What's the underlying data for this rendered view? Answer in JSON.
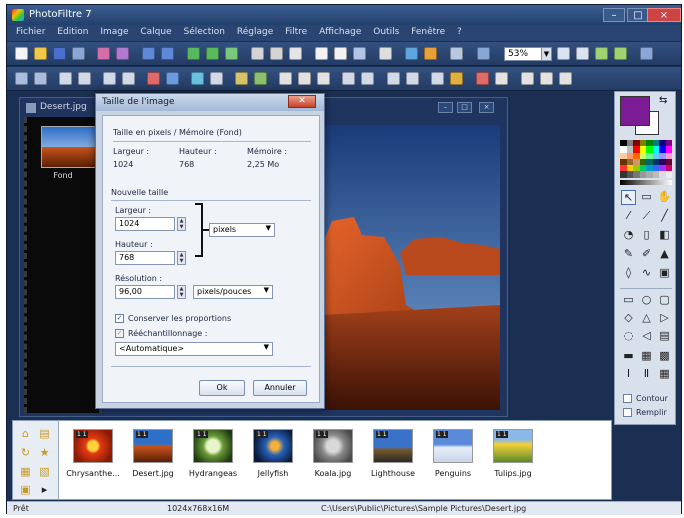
{
  "app": {
    "title": "PhotoFiltre 7"
  },
  "menu": [
    "Fichier",
    "Edition",
    "Image",
    "Calque",
    "Sélection",
    "Réglage",
    "Filtre",
    "Affichage",
    "Outils",
    "Fenêtre",
    "?"
  ],
  "toolbar": {
    "zoom_value": "53%"
  },
  "document": {
    "title": "Desert.jpg",
    "layer_label": "Fond"
  },
  "dialog": {
    "title": "Taille de l'image",
    "section_current": "Taille en pixels / Mémoire (Fond)",
    "current_width_label": "Largeur :",
    "current_height_label": "Hauteur :",
    "memory_label": "Mémoire :",
    "current_width": "1024",
    "current_height": "768",
    "memory": "2,25 Mo",
    "section_new": "Nouvelle taille",
    "width_label": "Largeur :",
    "width_value": "1024",
    "height_label": "Hauteur :",
    "height_value": "768",
    "unit_value": "pixels",
    "resolution_label": "Résolution :",
    "resolution_value": "96,00",
    "resolution_unit": "pixels/pouces",
    "keep_proportions": "Conserver les proportions",
    "resampling": "Rééchantillonnage :",
    "resampling_value": "<Automatique>",
    "ok": "Ok",
    "cancel": "Annuler"
  },
  "right_panel": {
    "outline_label": "Contour",
    "fill_label": "Remplir",
    "foreground_color": "#7b1c94",
    "background_color": "#ffffff"
  },
  "files": [
    {
      "name": "Chrysanthe...",
      "icon": "flower-red-thumbnail"
    },
    {
      "name": "Desert.jpg",
      "icon": "desert-thumbnail"
    },
    {
      "name": "Hydrangeas",
      "icon": "hydrangea-thumbnail"
    },
    {
      "name": "Jellyfish",
      "icon": "jellyfish-thumbnail"
    },
    {
      "name": "Koala.jpg",
      "icon": "koala-thumbnail"
    },
    {
      "name": "Lighthouse",
      "icon": "lighthouse-thumbnail"
    },
    {
      "name": "Penguins",
      "icon": "penguins-thumbnail"
    },
    {
      "name": "Tulips.jpg",
      "icon": "tulips-thumbnail"
    }
  ],
  "status": {
    "state": "Prêt",
    "size": "1024x768x16M",
    "path": "C:\\Users\\Public\\Pictures\\Sample Pictures\\Desert.jpg"
  }
}
